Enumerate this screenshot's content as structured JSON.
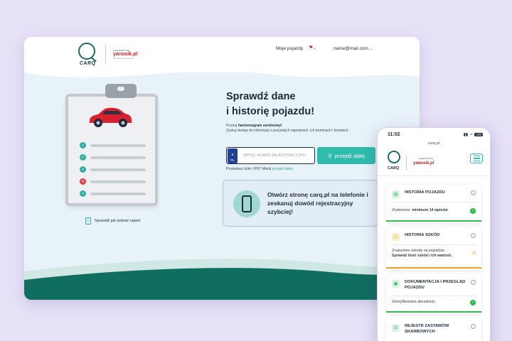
{
  "colors": {
    "teal": "#2fbcaa",
    "dark_green": "#1f6b62",
    "red_brand": "#c9202b",
    "bg": "#e6e1f7",
    "success": "#2eb84d",
    "warning": "#f0a020",
    "error": "#e23b4a"
  },
  "desktop": {
    "logo": {
      "word": "CARQ",
      "supported_by": "supported by",
      "partner": "yanosik.pl",
      "partner_sub": "niezawodny kierowca"
    },
    "nav": {
      "my_vehicles": "Moje pojazdy",
      "flag_icon": "pl-flag-icon",
      "user_email": "name@mail.com"
    },
    "hero": {
      "title_line1": "Sprawdź dane",
      "title_line2": "i historię pojazdu!",
      "lead_pre": "Poznaj ",
      "lead_bold": "harmonogram serwisowy!",
      "lead_rest": "Zyskuj dostęp do informacji o przyszłych naprawach, ich terminach i kosztach."
    },
    "search": {
      "plate_country": "PL",
      "placeholder": "WPISZ NUMER REJESTRACYJNY",
      "button_label": "przejdź dalej",
      "vin_prompt": "Posiadasz tylko VIN? kliknij ",
      "vin_link": "przejdź dalej"
    },
    "app_promo": {
      "text": "Otwórz stronę carq.pl na telefonie i zeskanuj dowód rejestracyjny szybciej!"
    },
    "clipboard": {
      "items": [
        "ok",
        "ok",
        "ok",
        "error",
        "ok"
      ]
    },
    "report_link": "Sprawdź jak pobrać raport"
  },
  "phone": {
    "time": "11:02",
    "battery": "100",
    "url": "carq.pl",
    "logo": {
      "word": "CARQ",
      "supported_by": "supported by",
      "partner": "yanosik.pl"
    },
    "cards": [
      {
        "title": "HISTORIA POJAZDU",
        "icon": "document-icon",
        "body_pre": "Znaleziono: ",
        "body_bold": "minimum 14 wpisów",
        "status": "success"
      },
      {
        "title": "HISTORIA SZKÓD",
        "icon": "damage-icon",
        "body_pre": "Znaleziono szkodę na pojeździe.",
        "body_bold": "Sprawdź ilość szkód i ich wartość.",
        "status": "warning"
      },
      {
        "title": "DOKUMENTACJA I PRZEGLĄD POJAZDU",
        "icon": "inspection-icon",
        "body_pre": "Zweryfikowano aktualność",
        "body_bold": "",
        "status": "success"
      },
      {
        "title": "REJESTR ZASTAWÓW SKARBOWYCH",
        "icon": "scales-icon",
        "body_pre": "",
        "body_bold": "",
        "status": ""
      }
    ]
  }
}
